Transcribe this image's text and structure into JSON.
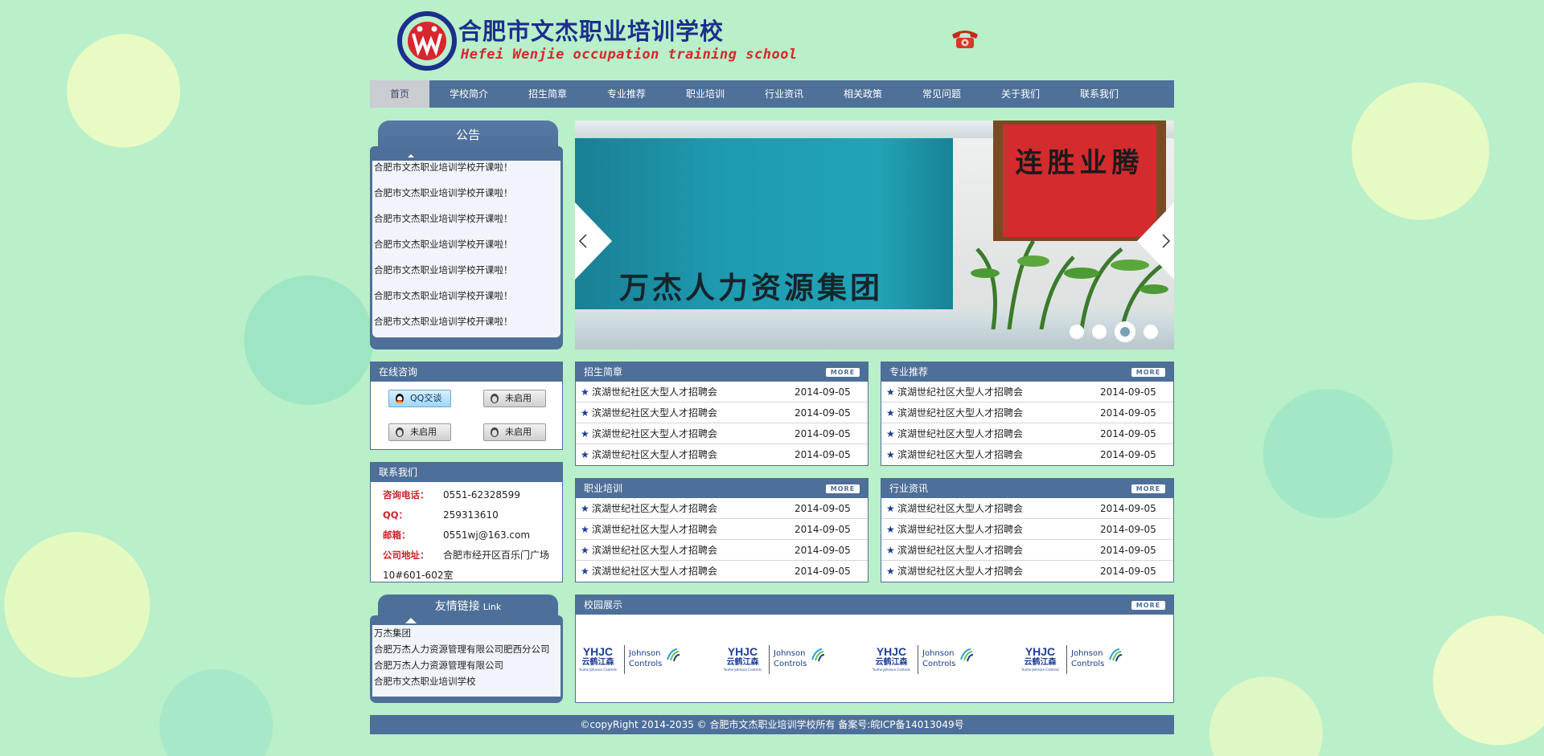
{
  "header": {
    "logo_cn": "合肥市文杰职业培训学校",
    "logo_en": "Hefei Wenjie occupation training school",
    "logo_icon": "wj-logo-icon",
    "phone_icon": "telephone-icon"
  },
  "nav": [
    {
      "label": "首页",
      "active": true
    },
    {
      "label": "学校简介"
    },
    {
      "label": "招生简章"
    },
    {
      "label": "专业推荐"
    },
    {
      "label": "职业培训"
    },
    {
      "label": "行业资讯"
    },
    {
      "label": "相关政策"
    },
    {
      "label": "常见问题"
    },
    {
      "label": "关于我们"
    },
    {
      "label": "联系我们"
    }
  ],
  "notice": {
    "title": "公告",
    "items": [
      "合肥市文杰职业培训学校开课啦！",
      "合肥市文杰职业培训学校开课啦！",
      "合肥市文杰职业培训学校开课啦！",
      "合肥市文杰职业培训学校开课啦！",
      "合肥市文杰职业培训学校开课啦！",
      "合肥市文杰职业培训学校开课啦！",
      "合肥市文杰职业培训学校开课啦！"
    ]
  },
  "slider": {
    "caption": "万杰人力资源集团",
    "calligraphy": "连胜业腾",
    "dots": 4,
    "active_dot": 3
  },
  "consult": {
    "title": "在线咨询",
    "buttons": [
      {
        "label": "QQ交谈",
        "on": true
      },
      {
        "label": "未启用",
        "on": false
      },
      {
        "label": "未启用",
        "on": false
      },
      {
        "label": "未启用",
        "on": false
      }
    ]
  },
  "contact": {
    "title": "联系我们",
    "phone_label": "咨询电话：",
    "phone": "0551-62328599",
    "qq_label": "QQ：",
    "qq": "259313610",
    "email_label": "邮箱：",
    "email": "0551wj@163.com",
    "addr_label": "公司地址：",
    "addr_1": "合肥市经开区百乐门广场",
    "addr_2": "10#601-602室"
  },
  "links": {
    "title": "友情链接",
    "title_en": "Link",
    "items": [
      "万杰集团",
      "合肥万杰人力资源管理有限公司肥西分公司",
      "合肥万杰人力资源管理有限公司",
      "合肥市文杰职业培训学校"
    ]
  },
  "more_label": "MORE",
  "news_panels": [
    {
      "title": "招生简章",
      "rows": [
        {
          "title": "滨湖世纪社区大型人才招聘会",
          "date": "2014-09-05"
        },
        {
          "title": "滨湖世纪社区大型人才招聘会",
          "date": "2014-09-05"
        },
        {
          "title": "滨湖世纪社区大型人才招聘会",
          "date": "2014-09-05"
        },
        {
          "title": "滨湖世纪社区大型人才招聘会",
          "date": "2014-09-05"
        }
      ]
    },
    {
      "title": "专业推荐",
      "rows": [
        {
          "title": "滨湖世纪社区大型人才招聘会",
          "date": "2014-09-05"
        },
        {
          "title": "滨湖世纪社区大型人才招聘会",
          "date": "2014-09-05"
        },
        {
          "title": "滨湖世纪社区大型人才招聘会",
          "date": "2014-09-05"
        },
        {
          "title": "滨湖世纪社区大型人才招聘会",
          "date": "2014-09-05"
        }
      ]
    },
    {
      "title": "职业培训",
      "rows": [
        {
          "title": "滨湖世纪社区大型人才招聘会",
          "date": "2014-09-05"
        },
        {
          "title": "滨湖世纪社区大型人才招聘会",
          "date": "2014-09-05"
        },
        {
          "title": "滨湖世纪社区大型人才招聘会",
          "date": "2014-09-05"
        },
        {
          "title": "滨湖世纪社区大型人才招聘会",
          "date": "2014-09-05"
        }
      ]
    },
    {
      "title": "行业资讯",
      "rows": [
        {
          "title": "滨湖世纪社区大型人才招聘会",
          "date": "2014-09-05"
        },
        {
          "title": "滨湖世纪社区大型人才招聘会",
          "date": "2014-09-05"
        },
        {
          "title": "滨湖世纪社区大型人才招聘会",
          "date": "2014-09-05"
        },
        {
          "title": "滨湖世纪社区大型人才招聘会",
          "date": "2014-09-05"
        }
      ]
    }
  ],
  "campus": {
    "title": "校园展示",
    "logo_yhjc": "YHJC",
    "logo_yhjc_cn": "云鹤江森",
    "logo_yhjc_en": "Yunhe Johnson Controls",
    "logo_jc_1": "Johnson",
    "logo_jc_2": "Controls"
  },
  "footer": "©copyRight 2014-2035 © 合肥市文杰职业培训学校所有 备案号:皖ICP备14013049号",
  "colors": {
    "primary": "#4e6f99",
    "label_red": "#d0202a",
    "logo_blue": "#1c2f8c",
    "logo_red": "#d8262e"
  }
}
